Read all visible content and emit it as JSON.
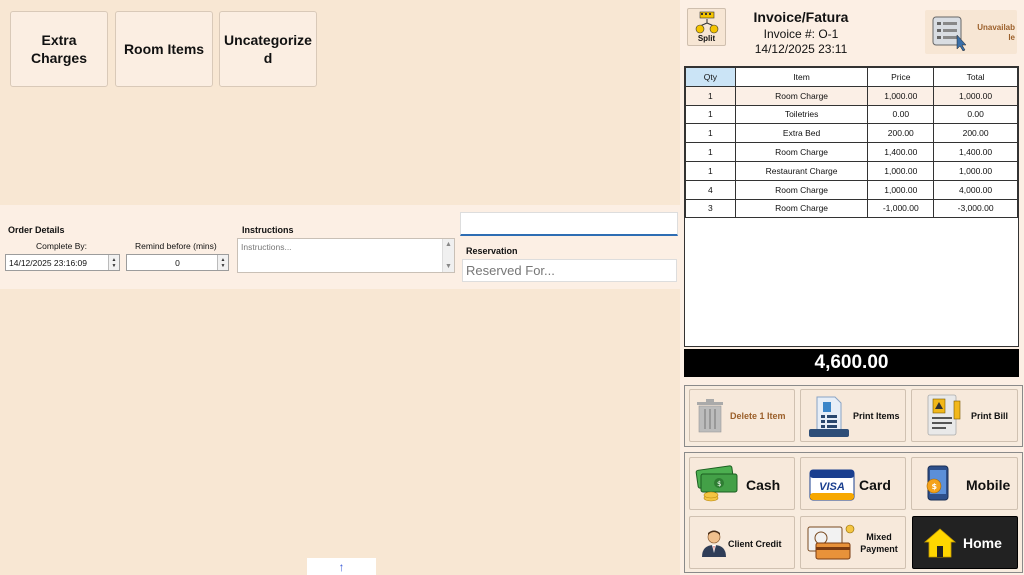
{
  "categories": [
    {
      "label": "Extra Charges"
    },
    {
      "label": "Room Items"
    },
    {
      "label": "Uncategorized"
    }
  ],
  "order_details": {
    "title": "Order Details",
    "complete_by_label": "Complete By:",
    "complete_by_value": "14/12/2025 23:16:09",
    "remind_label": "Remind before (mins)",
    "remind_value": "0"
  },
  "instructions": {
    "title": "Instructions",
    "placeholder": "Instructions..."
  },
  "reservation": {
    "title": "Reservation",
    "placeholder": "Reserved For..."
  },
  "invoice": {
    "split_label": "Split",
    "title": "Invoice/Fatura",
    "number": "Invoice #: O-1",
    "date": "14/12/2025 23:11",
    "unavailable_label": "Unavailable"
  },
  "table": {
    "headers": [
      "Qty",
      "Item",
      "Price",
      "Total"
    ],
    "rows": [
      [
        "1",
        "Room Charge",
        "1,000.00",
        "1,000.00"
      ],
      [
        "1",
        "Toiletries",
        "0.00",
        "0.00"
      ],
      [
        "1",
        "Extra Bed",
        "200.00",
        "200.00"
      ],
      [
        "1",
        "Room Charge",
        "1,400.00",
        "1,400.00"
      ],
      [
        "1",
        "Restaurant Charge",
        "1,000.00",
        "1,000.00"
      ],
      [
        "4",
        "Room Charge",
        "1,000.00",
        "4,000.00"
      ],
      [
        "3",
        "Room Charge",
        "-1,000.00",
        "-3,000.00"
      ]
    ]
  },
  "total": "4,600.00",
  "actions": {
    "delete_label": "Delete 1 Item",
    "print_items_label": "Print Items",
    "print_bill_label": "Print Bill"
  },
  "payments": {
    "cash_label": "Cash",
    "card_label": "Card",
    "mobile_label": "Mobile",
    "client_credit_label": "Client Credit",
    "mixed_label": "Mixed Payment",
    "home_label": "Home",
    "card_logo_text": "VISA"
  },
  "colors": {
    "background": "#f8e7d3",
    "accent_blue": "#2e6db3",
    "delete_text": "#9b5f2a",
    "home_icon": "#ffd600"
  }
}
